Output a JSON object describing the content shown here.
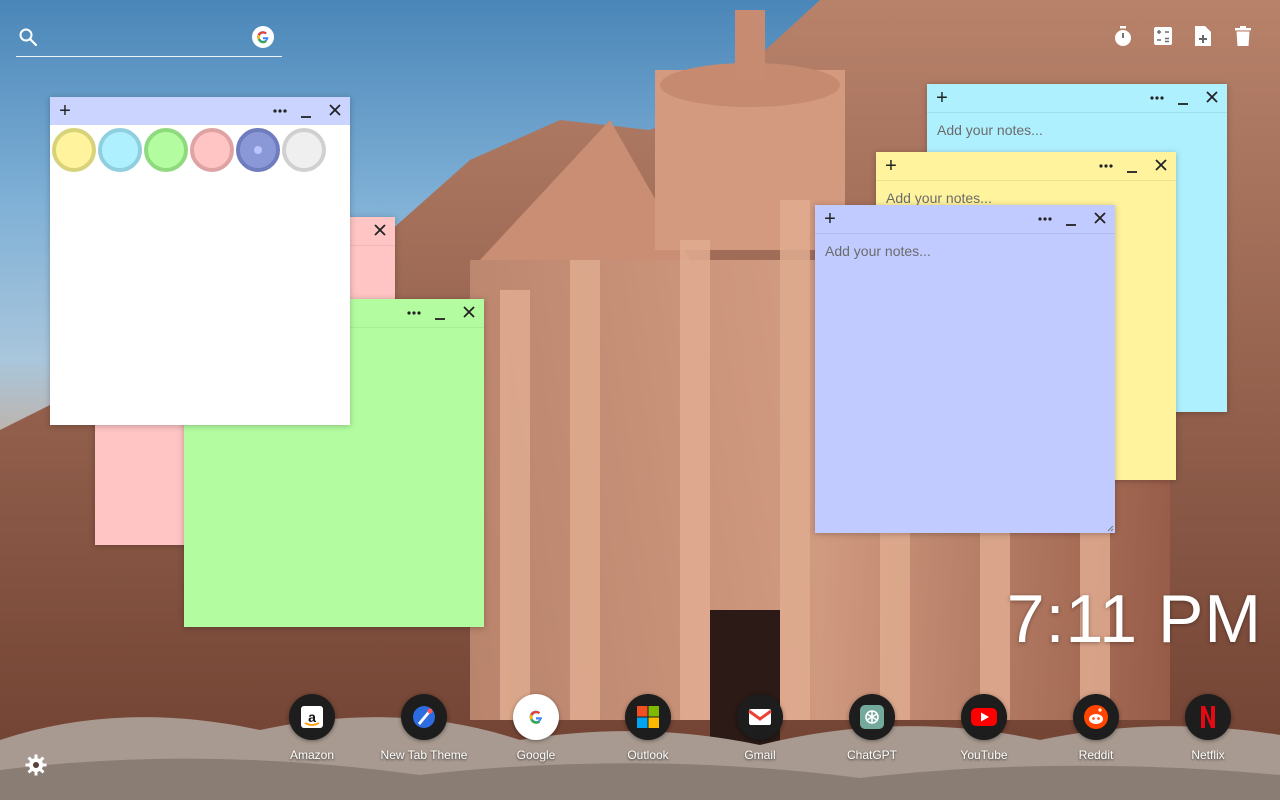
{
  "search": {
    "placeholder": ""
  },
  "toolbar": {
    "tools": [
      "timer-icon",
      "calculator-icon",
      "new-note-icon",
      "trash-icon"
    ]
  },
  "palette": {
    "swatches": [
      {
        "name": "yellow",
        "fill": "#fff39e",
        "border": "#d8d27a"
      },
      {
        "name": "cyan",
        "fill": "#aff0ff",
        "border": "#8fcfe0"
      },
      {
        "name": "green",
        "fill": "#b3fda0",
        "border": "#8fd97e"
      },
      {
        "name": "pink",
        "fill": "#ffc4c4",
        "border": "#e0a3a3"
      },
      {
        "name": "blue",
        "fill": "#8b98d8",
        "border": "#6f7cbd",
        "selected": true
      },
      {
        "name": "white",
        "fill": "#efefef",
        "border": "#d0d0d0"
      }
    ]
  },
  "notes": {
    "white": {
      "color": "#ffffff",
      "header_color": "#cbd3ff"
    },
    "pink": {
      "color": "#ffc4c4"
    },
    "green": {
      "color": "#b3fda0"
    },
    "cyan": {
      "color": "#aff0ff",
      "placeholder": "Add your notes..."
    },
    "yellow": {
      "color": "#fff39e",
      "placeholder": "Add your notes..."
    },
    "blue": {
      "color": "#c2cbff",
      "placeholder": "Add your notes..."
    }
  },
  "clock": {
    "time": "7:11 PM"
  },
  "dock": {
    "items": [
      {
        "label": "Amazon",
        "icon": "amazon-icon"
      },
      {
        "label": "New Tab Theme",
        "icon": "new-tab-theme-icon"
      },
      {
        "label": "Google",
        "icon": "google-icon"
      },
      {
        "label": "Outlook",
        "icon": "outlook-icon"
      },
      {
        "label": "Gmail",
        "icon": "gmail-icon"
      },
      {
        "label": "ChatGPT",
        "icon": "chatgpt-icon"
      },
      {
        "label": "YouTube",
        "icon": "youtube-icon"
      },
      {
        "label": "Reddit",
        "icon": "reddit-icon"
      },
      {
        "label": "Netflix",
        "icon": "netflix-icon"
      }
    ]
  }
}
